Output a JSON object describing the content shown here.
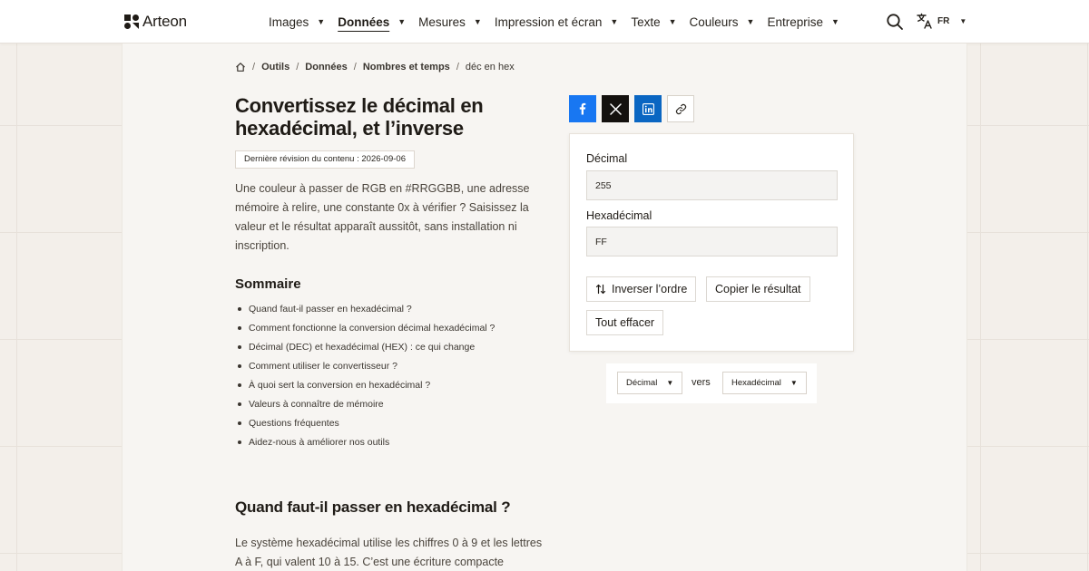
{
  "brand": {
    "name": "Arteon"
  },
  "nav": {
    "items": [
      {
        "label": "Images",
        "active": false
      },
      {
        "label": "Données",
        "active": true
      },
      {
        "label": "Mesures",
        "active": false
      },
      {
        "label": "Impression et écran",
        "active": false
      },
      {
        "label": "Texte",
        "active": false
      },
      {
        "label": "Couleurs",
        "active": false
      },
      {
        "label": "Entreprise",
        "active": false
      }
    ],
    "language": "FR"
  },
  "breadcrumb": {
    "items": [
      "Outils",
      "Données",
      "Nombres et temps"
    ],
    "current": "déc en hex"
  },
  "page": {
    "title": "Convertissez le décimal en hexadécimal, et l’inverse",
    "revision": "Dernière révision du contenu : 2026-09-06",
    "intro": "Une couleur à passer de RGB en #RRGGBB, une adresse mémoire à relire, une constante 0x à vérifier ? Saisissez la valeur et le résultat apparaît aussitôt, sans installation ni inscription."
  },
  "toc": {
    "title": "Sommaire",
    "items": [
      "Quand faut-il passer en hexadécimal ?",
      "Comment fonctionne la conversion décimal hexadécimal ?",
      "Décimal (DEC) et hexadécimal (HEX) : ce qui change",
      "Comment utiliser le convertisseur ?",
      "À quoi sert la conversion en hexadécimal ?",
      "Valeurs à connaître de mémoire",
      "Questions fréquentes",
      "Aidez-nous à améliorer nos outils"
    ]
  },
  "section": {
    "title": "Quand faut-il passer en hexadécimal ?",
    "body": "Le système hexadécimal utilise les chiffres 0 à 9 et les lettres A à F, qui valent 10 à 15. C’est une écriture compacte"
  },
  "share": {
    "icons": [
      "facebook-icon",
      "x-icon",
      "linkedin-icon",
      "link-icon"
    ],
    "colors": {
      "facebook": "#1877f2",
      "x": "#14110e",
      "linkedin": "#0a66c2"
    }
  },
  "converter": {
    "decimal_label": "Décimal",
    "decimal_value": "255",
    "hex_label": "Hexadécimal",
    "hex_value": "FF",
    "swap_label": "Inverser l’ordre",
    "copy_label": "Copier le résultat",
    "clear_label": "Tout effacer"
  },
  "units": {
    "from": "Décimal",
    "connector": "vers",
    "to": "Hexadécimal"
  }
}
